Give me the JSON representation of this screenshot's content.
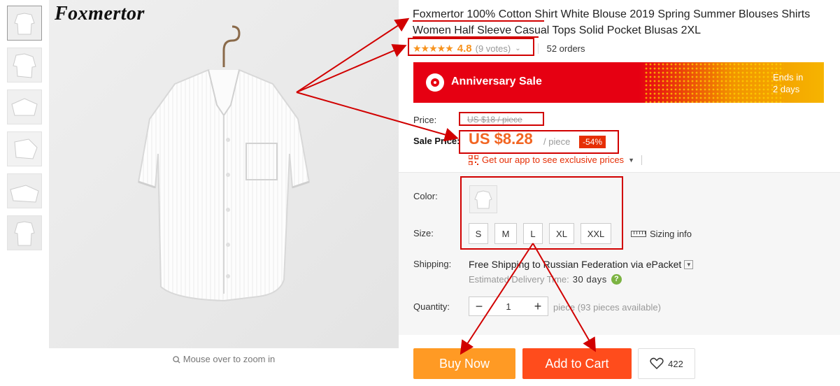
{
  "product": {
    "title": "Foxmertor 100% Cotton Shirt White Blouse 2019 Spring Summer Blouses Shirts Women Half Sleeve Casual Tops Solid Pocket Blusas 2XL",
    "brand_logo": "Foxmertor"
  },
  "gallery": {
    "thumbnail_count": 6,
    "zoom_hint": "Mouse over to zoom in"
  },
  "rating": {
    "stars": "★★★★★",
    "value": "4.8",
    "votes": "(9 votes)",
    "orders": "52 orders"
  },
  "promo_banner": {
    "title": "Anniversary Sale",
    "ends_line1": "Ends in",
    "ends_line2": "2 days"
  },
  "price": {
    "label": "Price:",
    "original": "US $18 / piece",
    "sale_label": "Sale Price:",
    "sale": "US $8.28",
    "unit": "/ piece",
    "discount": "-54%"
  },
  "app_promo": {
    "text": "Get our app to see exclusive prices"
  },
  "options": {
    "color_label": "Color:",
    "size_label": "Size:",
    "sizes": [
      "S",
      "M",
      "L",
      "XL",
      "XXL"
    ],
    "sizing_info": "Sizing info"
  },
  "shipping": {
    "label": "Shipping:",
    "text": "Free Shipping to Russian Federation via ePacket",
    "delivery_label": "Estimated Delivery Time:",
    "delivery_days": "30 days"
  },
  "quantity": {
    "label": "Quantity:",
    "value": "1",
    "note": "piece (93 pieces available)"
  },
  "actions": {
    "buy_now": "Buy Now",
    "add_to_cart": "Add to Cart",
    "wishlist_count": "422"
  },
  "colors": {
    "accent_orange": "#f26522",
    "buy_now_bg": "#ff9a24",
    "add_to_cart_bg": "#ff4c1c",
    "discount_bg": "#e62e04",
    "annotation_red": "#d10000"
  }
}
